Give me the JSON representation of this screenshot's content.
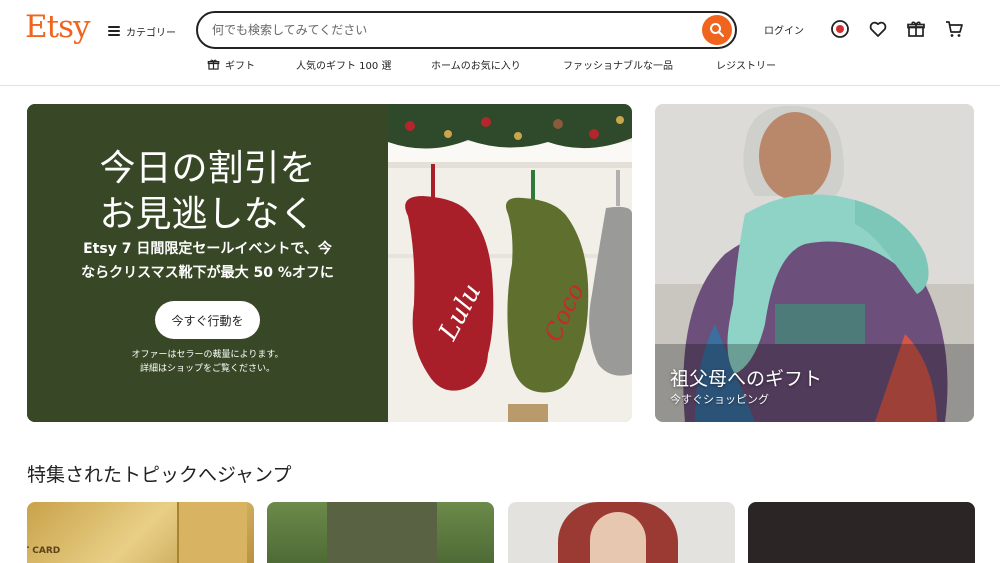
{
  "header": {
    "logo": "Etsy",
    "categories_label": "カテゴリー",
    "search": {
      "placeholder": "何でも検索してみてください",
      "value": ""
    },
    "login_label": "ログイン",
    "icons": [
      "search-icon",
      "record-icon",
      "heart-icon",
      "gift-icon",
      "cart-icon"
    ]
  },
  "subnav": {
    "items": [
      {
        "label": "ギフト",
        "icon": "gift-icon"
      },
      {
        "label": "人気のギフト 100 選"
      },
      {
        "label": "ホームのお気に入り"
      },
      {
        "label": "ファッショナブルな一品"
      },
      {
        "label": "レジストリー"
      }
    ]
  },
  "hero": {
    "title_line1": "今日の割引を",
    "title_line2": "お見逃しなく",
    "subtitle_line1": "Etsy 7 日間限定セールイベントで、今",
    "subtitle_line2": "ならクリスマス靴下が最大 50 %オフに",
    "cta_label": "今すぐ行動を",
    "note_line1": "オファーはセラーの裁量によります。",
    "note_line2": "詳細はショップをご覧ください。",
    "stocking_names": [
      "Lulu",
      "Coco"
    ]
  },
  "side_banner": {
    "title": "祖父母へのギフト",
    "link_label": "今すぐショッピング"
  },
  "featured": {
    "title": "特集されたトピックへジャンプ",
    "card_text": "T CARD"
  },
  "colors": {
    "brand": "#f1641e",
    "hero_bg": "#384826",
    "text": "#222222"
  }
}
